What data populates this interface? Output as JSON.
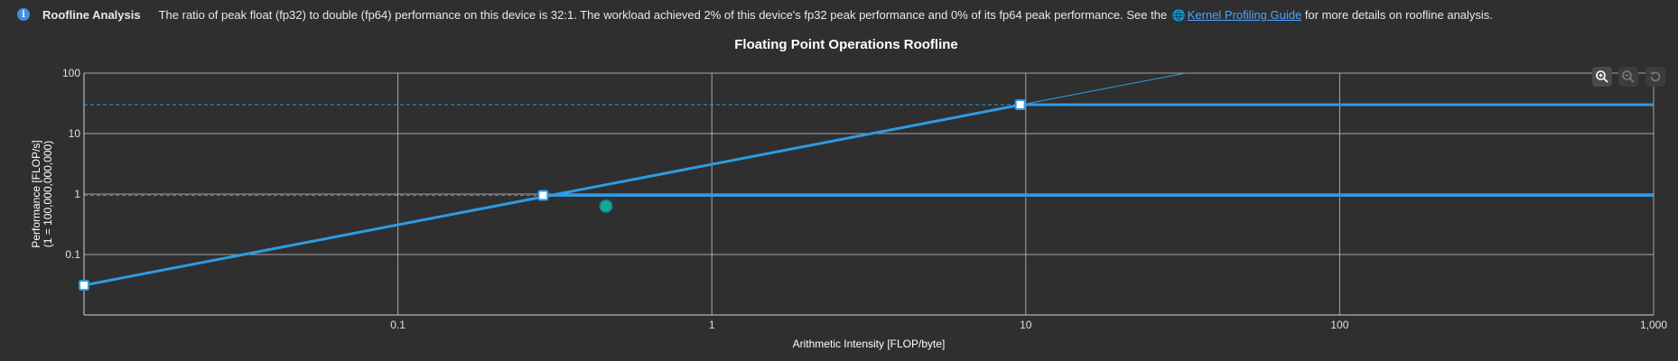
{
  "info": {
    "title": "Roofline Analysis",
    "text_before": "The ratio of peak float (fp32) to double (fp64) performance on this device is 32:1. The workload achieved 2% of this device's fp32 peak performance and 0% of its fp64 peak performance. See the ",
    "link_text": "Kernel Profiling Guide",
    "text_after": " for more details on roofline analysis."
  },
  "chart_data": {
    "type": "line",
    "title": "Floating Point Operations Roofline",
    "xlabel": "Arithmetic Intensity [FLOP/byte]",
    "ylabel": "Performance [FLOP/s]",
    "ylabel_unit": "(1 = 100,000,000,000)",
    "x_scale": "log",
    "y_scale": "log",
    "xlim": [
      0.01,
      1000
    ],
    "ylim": [
      0.01,
      100
    ],
    "x_ticks": [
      0.1,
      1,
      10,
      100,
      1000
    ],
    "x_tick_labels": [
      "0.1",
      "1",
      "10",
      "100",
      "1,000"
    ],
    "y_ticks": [
      0.1,
      1,
      10,
      100
    ],
    "y_tick_labels": [
      "0.1",
      "1",
      "10",
      "100"
    ],
    "grid": true,
    "series": [
      {
        "ridge_x": 9.6,
        "peak_y": 30,
        "color": "#2d9be3"
      },
      {
        "ridge_x": 0.29,
        "peak_y": 0.95,
        "color": "#2d9be3"
      }
    ],
    "bandwidth_slope_line": {
      "y_at_x_0_01": 0.031
    },
    "achieved_point": {
      "x": 0.46,
      "y": 0.63,
      "color": "#13a89e"
    }
  },
  "toolbar": {
    "zoom_in_icon": "zoom-in-icon",
    "zoom_out_icon": "zoom-out-icon",
    "reset_icon": "reset-zoom-icon"
  }
}
